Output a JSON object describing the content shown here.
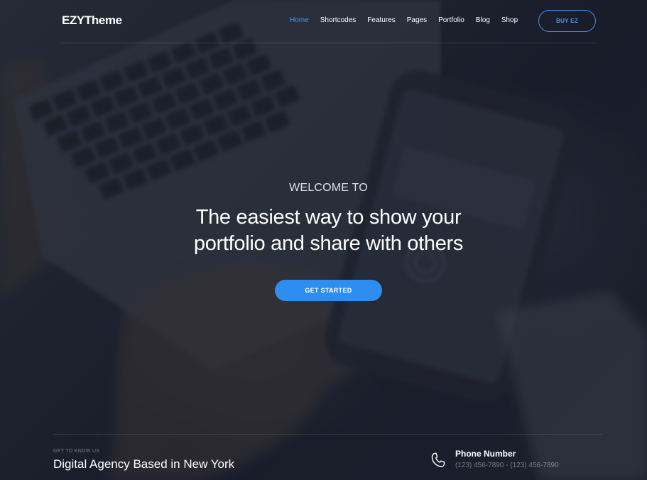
{
  "header": {
    "logo": "EZYTheme",
    "nav": [
      {
        "label": "Home",
        "active": true
      },
      {
        "label": "Shortcodes",
        "active": false
      },
      {
        "label": "Features",
        "active": false
      },
      {
        "label": "Pages",
        "active": false
      },
      {
        "label": "Portfolio",
        "active": false
      },
      {
        "label": "Blog",
        "active": false
      },
      {
        "label": "Shop",
        "active": false
      }
    ],
    "buy_button": "BUY EZ"
  },
  "hero": {
    "welcome": "WELCOME TO",
    "headline_line1": "The easiest way to show your",
    "headline_line2": "portfolio and share with others",
    "cta": "GET STARTED"
  },
  "info": {
    "eyebrow": "GET TO KNOW US",
    "title": "Digital Agency Based in New York",
    "phone_label": "Phone Number",
    "phone_value": "(123) 456-7890 - (123) 456-7890",
    "phone_icon": "phone-icon"
  },
  "colors": {
    "accent": "#2e8ef0",
    "active_nav": "#3d9bf2"
  }
}
